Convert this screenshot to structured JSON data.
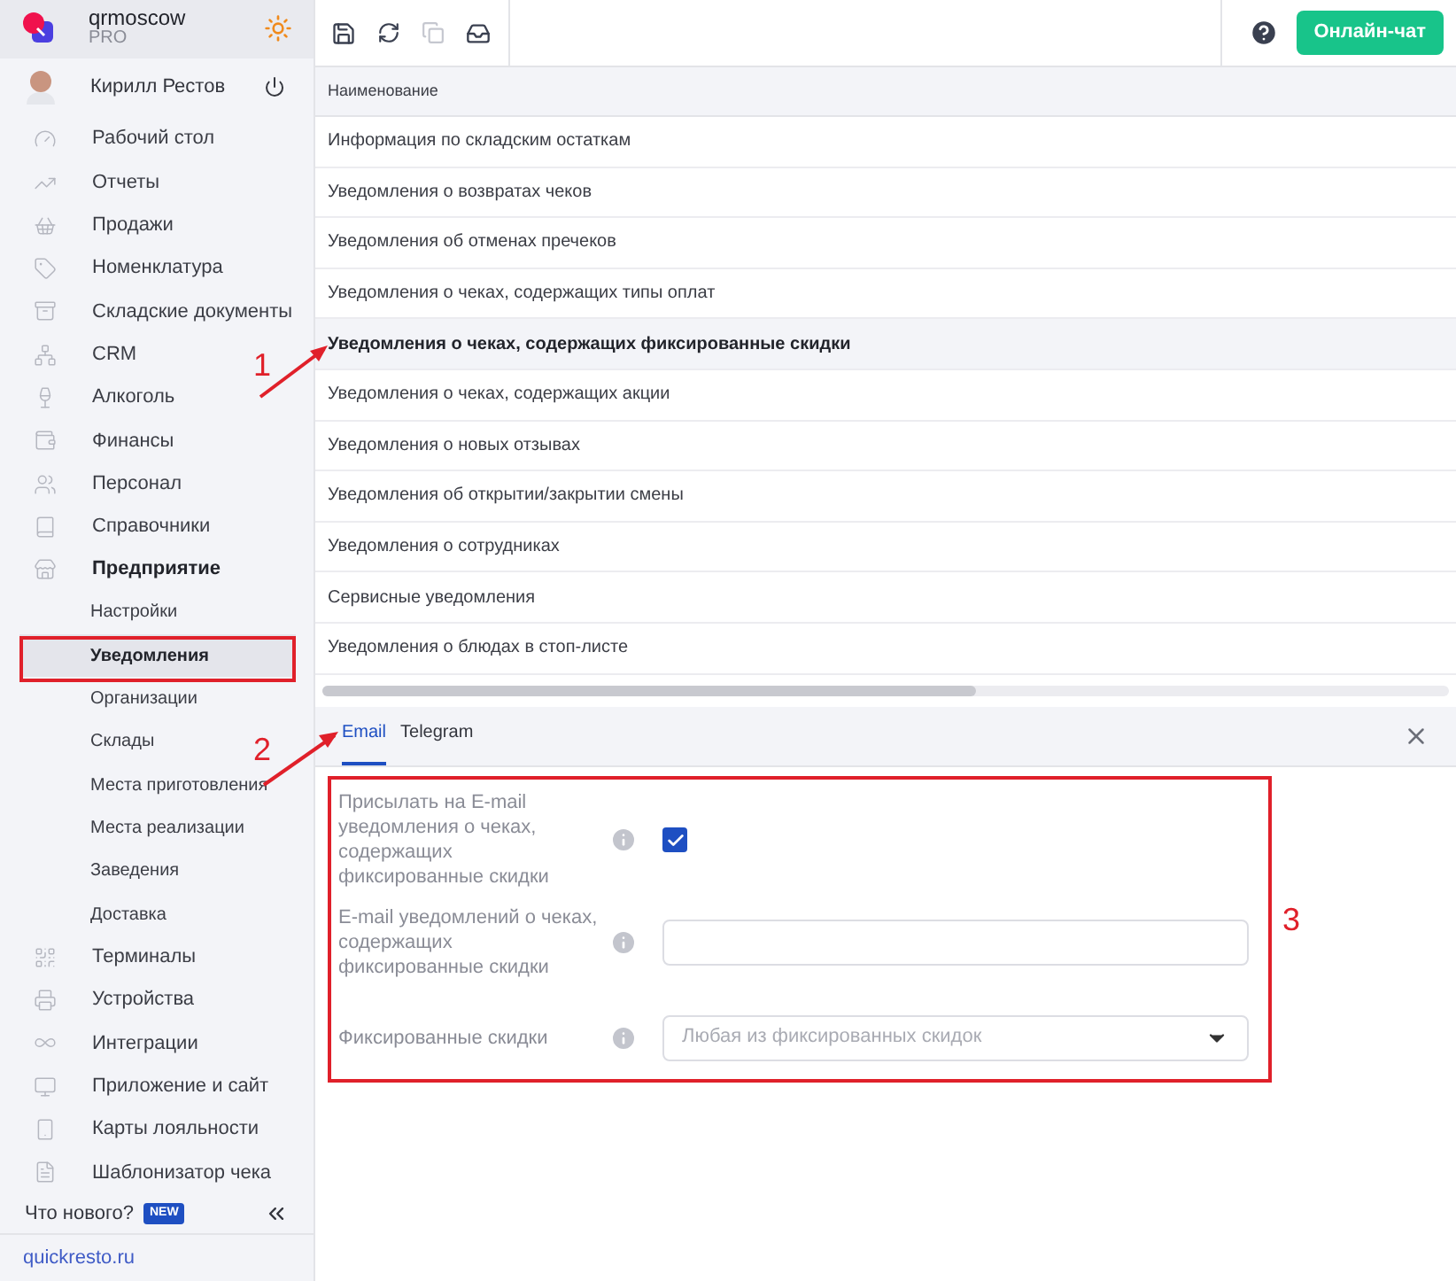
{
  "app": {
    "name": "qrmoscow",
    "plan": "PRO"
  },
  "user": {
    "name": "Кирилл Рестов"
  },
  "nav": [
    {
      "kind": "main",
      "label": "Рабочий стол",
      "bold": false,
      "selected": false
    },
    {
      "kind": "main",
      "label": "Отчеты",
      "bold": false,
      "selected": false
    },
    {
      "kind": "main",
      "label": "Продажи",
      "bold": false,
      "selected": false
    },
    {
      "kind": "main",
      "label": "Номенклатура",
      "bold": false,
      "selected": false
    },
    {
      "kind": "main",
      "label": "Складские документы",
      "bold": false,
      "selected": false
    },
    {
      "kind": "main",
      "label": "CRM",
      "bold": false,
      "selected": false
    },
    {
      "kind": "main",
      "label": "Алкоголь",
      "bold": false,
      "selected": false
    },
    {
      "kind": "main",
      "label": "Финансы",
      "bold": false,
      "selected": false
    },
    {
      "kind": "main",
      "label": "Персонал",
      "bold": false,
      "selected": false
    },
    {
      "kind": "main",
      "label": "Справочники",
      "bold": false,
      "selected": false
    },
    {
      "kind": "main",
      "label": "Предприятие",
      "bold": true,
      "selected": false
    },
    {
      "kind": "sub",
      "label": "Настройки",
      "bold": false,
      "selected": false
    },
    {
      "kind": "sub",
      "label": "Уведомления",
      "bold": true,
      "selected": true
    },
    {
      "kind": "sub",
      "label": "Организации",
      "bold": false,
      "selected": false
    },
    {
      "kind": "sub",
      "label": "Склады",
      "bold": false,
      "selected": false
    },
    {
      "kind": "sub",
      "label": "Места приготовления",
      "bold": false,
      "selected": false
    },
    {
      "kind": "sub",
      "label": "Места реализации",
      "bold": false,
      "selected": false
    },
    {
      "kind": "sub",
      "label": "Заведения",
      "bold": false,
      "selected": false
    },
    {
      "kind": "sub",
      "label": "Доставка",
      "bold": false,
      "selected": false
    },
    {
      "kind": "main",
      "label": "Терминалы",
      "bold": false,
      "selected": false
    },
    {
      "kind": "main",
      "label": "Устройства",
      "bold": false,
      "selected": false
    },
    {
      "kind": "main",
      "label": "Интеграции",
      "bold": false,
      "selected": false
    },
    {
      "kind": "main",
      "label": "Приложение и сайт",
      "bold": false,
      "selected": false
    },
    {
      "kind": "main",
      "label": "Карты лояльности",
      "bold": false,
      "selected": false
    },
    {
      "kind": "main",
      "label": "Шаблонизатор чека",
      "bold": false,
      "selected": false
    }
  ],
  "footer": {
    "whats_new": "Что нового?",
    "badge": "NEW",
    "link": "quickresto.ru"
  },
  "toolbar": {
    "chat": "Онлайн-чат"
  },
  "table": {
    "column": "Наименование",
    "rows": [
      {
        "label": "Информация по складским остаткам",
        "selected": false
      },
      {
        "label": "Уведомления о возвратах чеков",
        "selected": false
      },
      {
        "label": "Уведомления об отменах пречеков",
        "selected": false
      },
      {
        "label": "Уведомления о чеках, содержащих типы оплат",
        "selected": false
      },
      {
        "label": "Уведомления о чеках, содержащих фиксированные скидки",
        "selected": true
      },
      {
        "label": "Уведомления о чеках, содержащих акции",
        "selected": false
      },
      {
        "label": "Уведомления о новых отзывах",
        "selected": false
      },
      {
        "label": "Уведомления об открытии/закрытии смены",
        "selected": false
      },
      {
        "label": "Уведомления о сотрудниках",
        "selected": false
      },
      {
        "label": "Сервисные уведомления",
        "selected": false
      },
      {
        "label": "Уведомления о блюдах в стоп-листе",
        "selected": false
      }
    ]
  },
  "tabs": [
    {
      "label": "Email",
      "selected": true
    },
    {
      "label": "Telegram",
      "selected": false
    }
  ],
  "form": [
    {
      "kind": "checkbox",
      "label": "Присылать на E-mail уведомления о чеках, содержащих фиксированные скидки",
      "checked": true
    },
    {
      "kind": "text",
      "label": "E-mail уведомлений о чеках, содержащих фиксированные скидки"
    },
    {
      "kind": "select",
      "label": "Фиксированные скидки",
      "placeholder": "Любая из фиксированных скидок"
    }
  ],
  "annotations": [
    "1",
    "2",
    "3"
  ]
}
